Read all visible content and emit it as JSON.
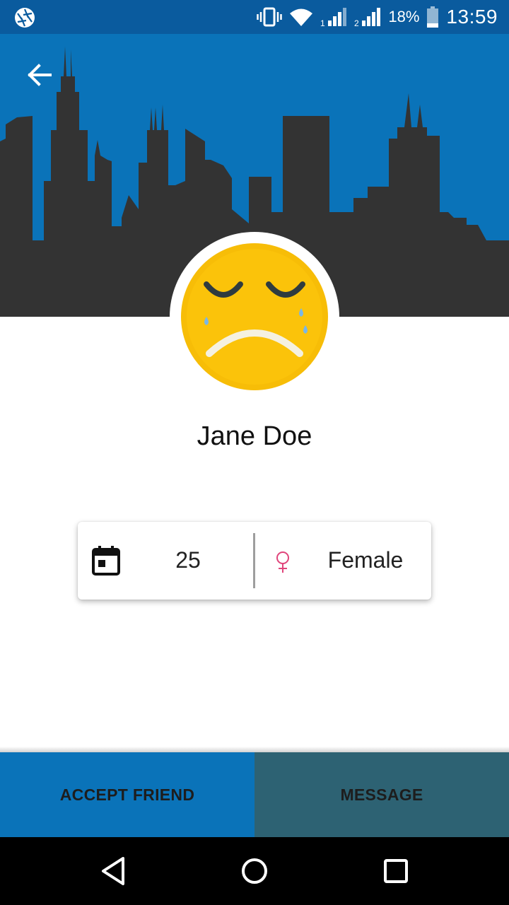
{
  "status_bar": {
    "battery_percent": "18%",
    "time": "13:59",
    "sim1_label": "1",
    "sim2_label": "2",
    "icons": [
      "camera-aperture-icon",
      "vibrate-icon",
      "wifi-icon",
      "signal-sim1-icon",
      "signal-sim2-icon",
      "battery-icon"
    ]
  },
  "header": {
    "back_icon": "arrow-left-icon",
    "background_color": "#0a73b9",
    "skyline_color": "#333333"
  },
  "profile": {
    "avatar_icon": "crying-face-emoji",
    "name": "Jane Doe"
  },
  "info_card": {
    "age_icon": "calendar-icon",
    "age": "25",
    "gender_icon": "female-symbol-icon",
    "gender": "Female"
  },
  "actions": {
    "accept_label": "ACCEPT FRIEND",
    "message_label": "MESSAGE",
    "accept_color": "#0a73b9",
    "message_color": "#2d6273"
  },
  "nav_bar": {
    "icons": [
      "nav-back-icon",
      "nav-home-icon",
      "nav-recents-icon"
    ]
  }
}
